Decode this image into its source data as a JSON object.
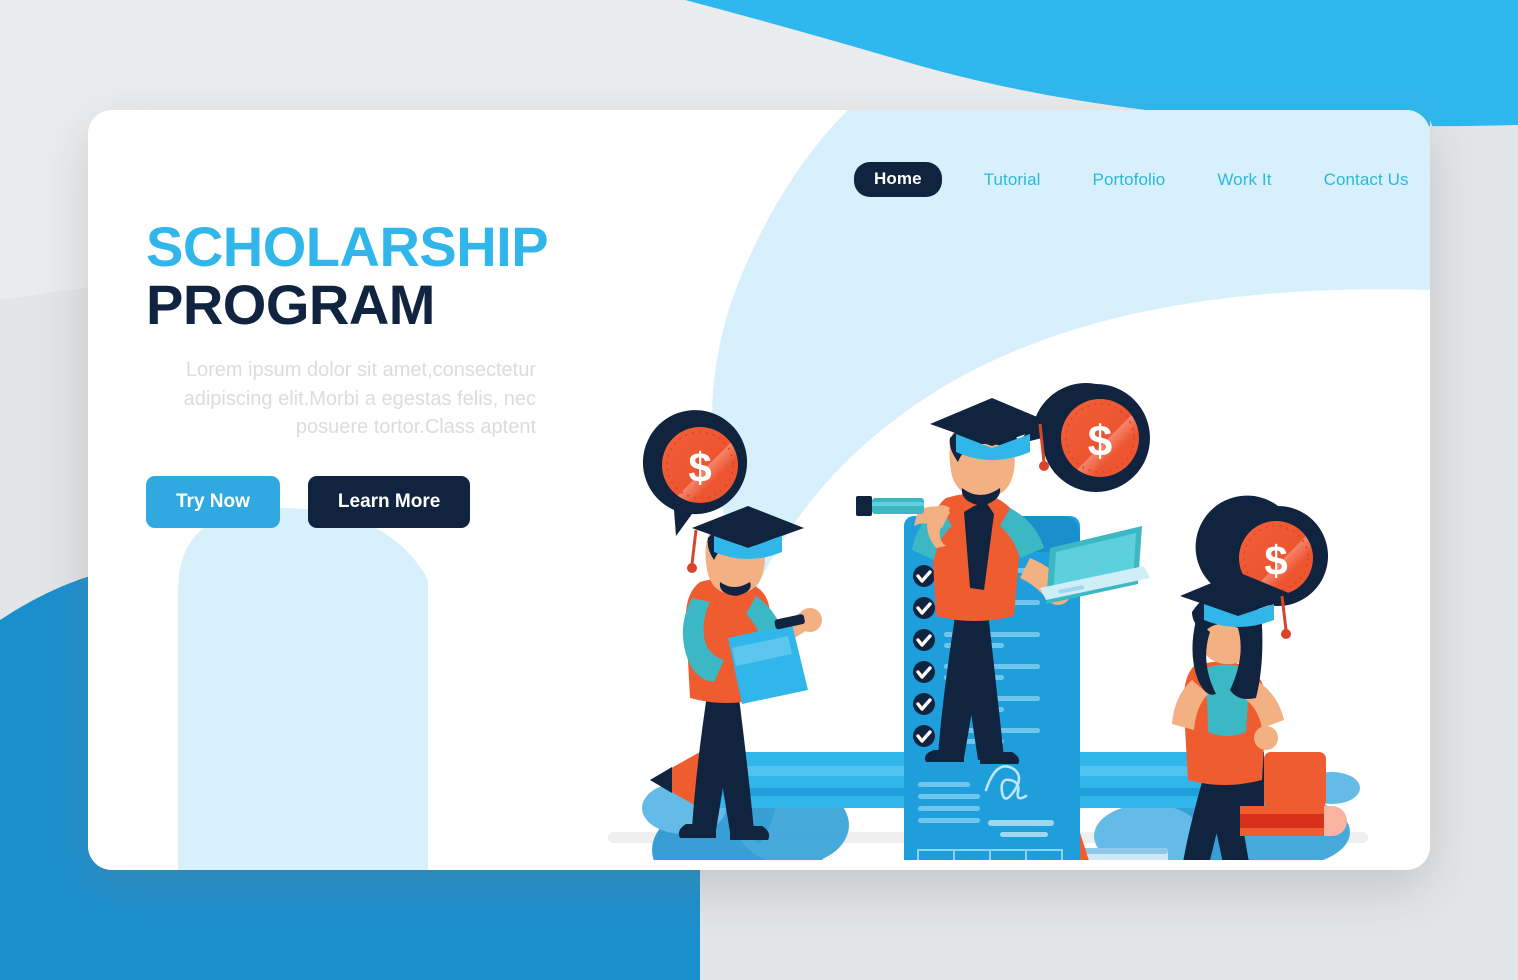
{
  "page": {
    "background_color": "#e4e5e6",
    "card_color": "#ffffff",
    "accent_blue": "#31b6ea",
    "accent_navy": "#10243f",
    "accent_teal": "#2bb9d9",
    "accent_orange": "#ef5c30"
  },
  "nav": {
    "items": [
      {
        "label": "Home",
        "active": true
      },
      {
        "label": "Tutorial",
        "active": false
      },
      {
        "label": "Portofolio",
        "active": false
      },
      {
        "label": "Work It",
        "active": false
      },
      {
        "label": "Contact Us",
        "active": false
      }
    ]
  },
  "hero": {
    "title_line1": "SCHOLARSHIP",
    "title_line2": "PROGRAM",
    "paragraph": "Lorem ipsum dolor sit amet,consectetur adipiscing elit.Morbi a egestas felis, nec posuere tortor.Class aptent",
    "primary_button": "Try Now",
    "secondary_button": "Learn More"
  },
  "illustration": {
    "name": "scholarship-program-illustration",
    "badges": [
      {
        "name": "dollar-badge-left",
        "symbol": "$"
      },
      {
        "name": "dollar-badge-center",
        "symbol": "$"
      },
      {
        "name": "dollar-badge-right",
        "symbol": "$"
      }
    ],
    "document": {
      "name": "checklist-document",
      "checkmark_count": 6,
      "table_columns": 4,
      "table_rows": 5,
      "has_signature": true
    },
    "characters": [
      {
        "name": "student-with-clipboard",
        "position": "left"
      },
      {
        "name": "graduate-with-telescope-and-laptop",
        "position": "center"
      },
      {
        "name": "graduate-with-pencil",
        "position": "right"
      }
    ],
    "objects": [
      {
        "name": "giant-pencil"
      },
      {
        "name": "book-stack"
      },
      {
        "name": "laptop"
      }
    ]
  }
}
